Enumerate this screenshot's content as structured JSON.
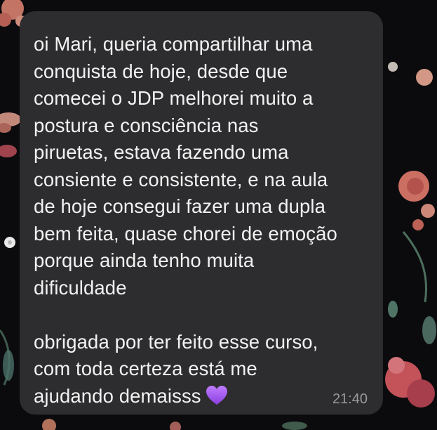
{
  "message": {
    "paragraph_1": "oi Mari, queria compartilhar uma\nconquista de hoje, desde que\ncomecei o JDP melhorei muito a\npostura e consciência nas\npiruetas, estava fazendo uma\nconsiente e consistente, e na aula\nde hoje consegui fazer uma dupla\nbem feita, quase chorei de emoção\nporque  ainda tenho muita\ndificuldade",
    "paragraph_2": "obrigada por ter feito esse curso,\ncom toda certeza está me\najudando demaisss",
    "emoji": "purple-heart-icon",
    "timestamp": "21:40"
  },
  "colors": {
    "bubble": "#2d2d2f",
    "text": "#f2f2f2",
    "timestamp": "#9a9a9c",
    "heart": "#a45bf0",
    "wallpaper": "#0b0b0d"
  }
}
